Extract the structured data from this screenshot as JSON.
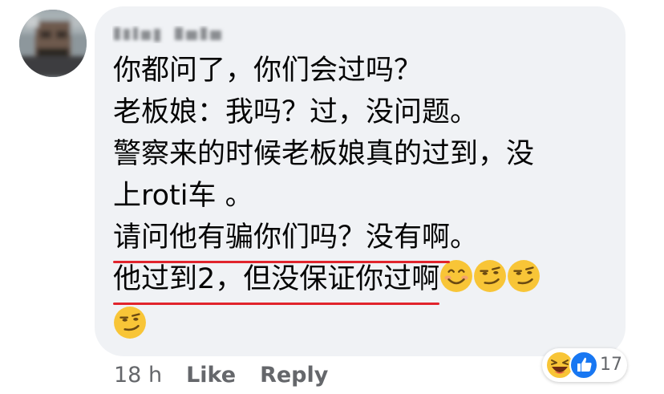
{
  "comment": {
    "author_name": "",
    "lines": [
      {
        "text": "你都问了，你们会过吗？"
      },
      {
        "text": "老板娘：我吗？过，没问题。"
      },
      {
        "text": "警察来的时候老板娘真的过到，没"
      },
      {
        "text": "上roti车 。"
      },
      {
        "underlined": "请问他有骗你们吗？没有啊",
        "rest": "。"
      },
      {
        "underlined": "他过到2，但没保证你过啊",
        "emojis": [
          "smiling-face-icon",
          "smirking-face-icon",
          "smirking-face-icon"
        ]
      },
      {
        "emojis": [
          "smirking-face-icon"
        ]
      }
    ]
  },
  "actions": {
    "time": "18 h",
    "like_label": "Like",
    "reply_label": "Reply"
  },
  "reactions": {
    "icons": [
      "laughing-face-icon",
      "like-thumb-icon"
    ],
    "count": "17"
  },
  "colors": {
    "bubble": "#f0f2f5",
    "underline": "#e1242c",
    "meta_text": "#65676b",
    "like_blue": "#1877f2",
    "emoji_yellow": "#f8c537"
  }
}
